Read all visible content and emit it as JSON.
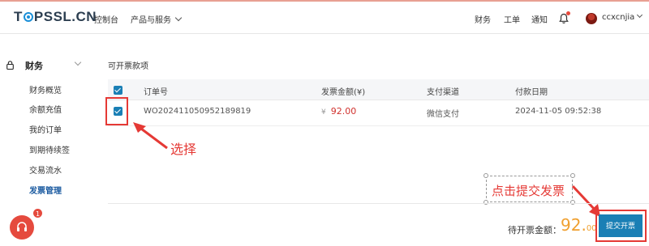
{
  "header": {
    "logo_prefix": "T",
    "logo_suffix": "PSSL.CN",
    "nav": {
      "console": "控制台",
      "products": "产品与服务"
    },
    "right": {
      "finance": "财务",
      "tickets": "工单",
      "notifications": "通知",
      "username": "ccxcnjia"
    }
  },
  "sidebar": {
    "group": "财务",
    "items": [
      {
        "label": "财务概览"
      },
      {
        "label": "余额充值"
      },
      {
        "label": "我的订单"
      },
      {
        "label": "到期待续签"
      },
      {
        "label": "交易流水"
      },
      {
        "label": "发票管理"
      }
    ]
  },
  "main": {
    "section_title": "可开票款项",
    "columns": {
      "order": "订单号",
      "amount": "发票金额(¥)",
      "channel": "支付渠道",
      "date": "付款日期"
    },
    "rows": [
      {
        "order": "WO20241105095218981​9",
        "currency": "¥",
        "amount": "92.00",
        "channel": "微信支付",
        "date": "2024-11-05 09:52:38"
      }
    ],
    "pending_label": "待开票金额：",
    "pending_int": "92.",
    "pending_dec": "00",
    "submit_label": "提交开票"
  },
  "annotations": {
    "select": "选择",
    "click_submit": "点击提交发票"
  },
  "support": {
    "badge": "1"
  },
  "colors": {
    "accent": "#1a7fb5",
    "amount": "#d0312d",
    "pending": "#f0a030",
    "annotation": "#e53935"
  },
  "icons": [
    "lock-icon",
    "chevron-down-icon",
    "bell-icon",
    "avatar",
    "headset-icon",
    "checkmark-icon",
    "arrow-icon"
  ]
}
